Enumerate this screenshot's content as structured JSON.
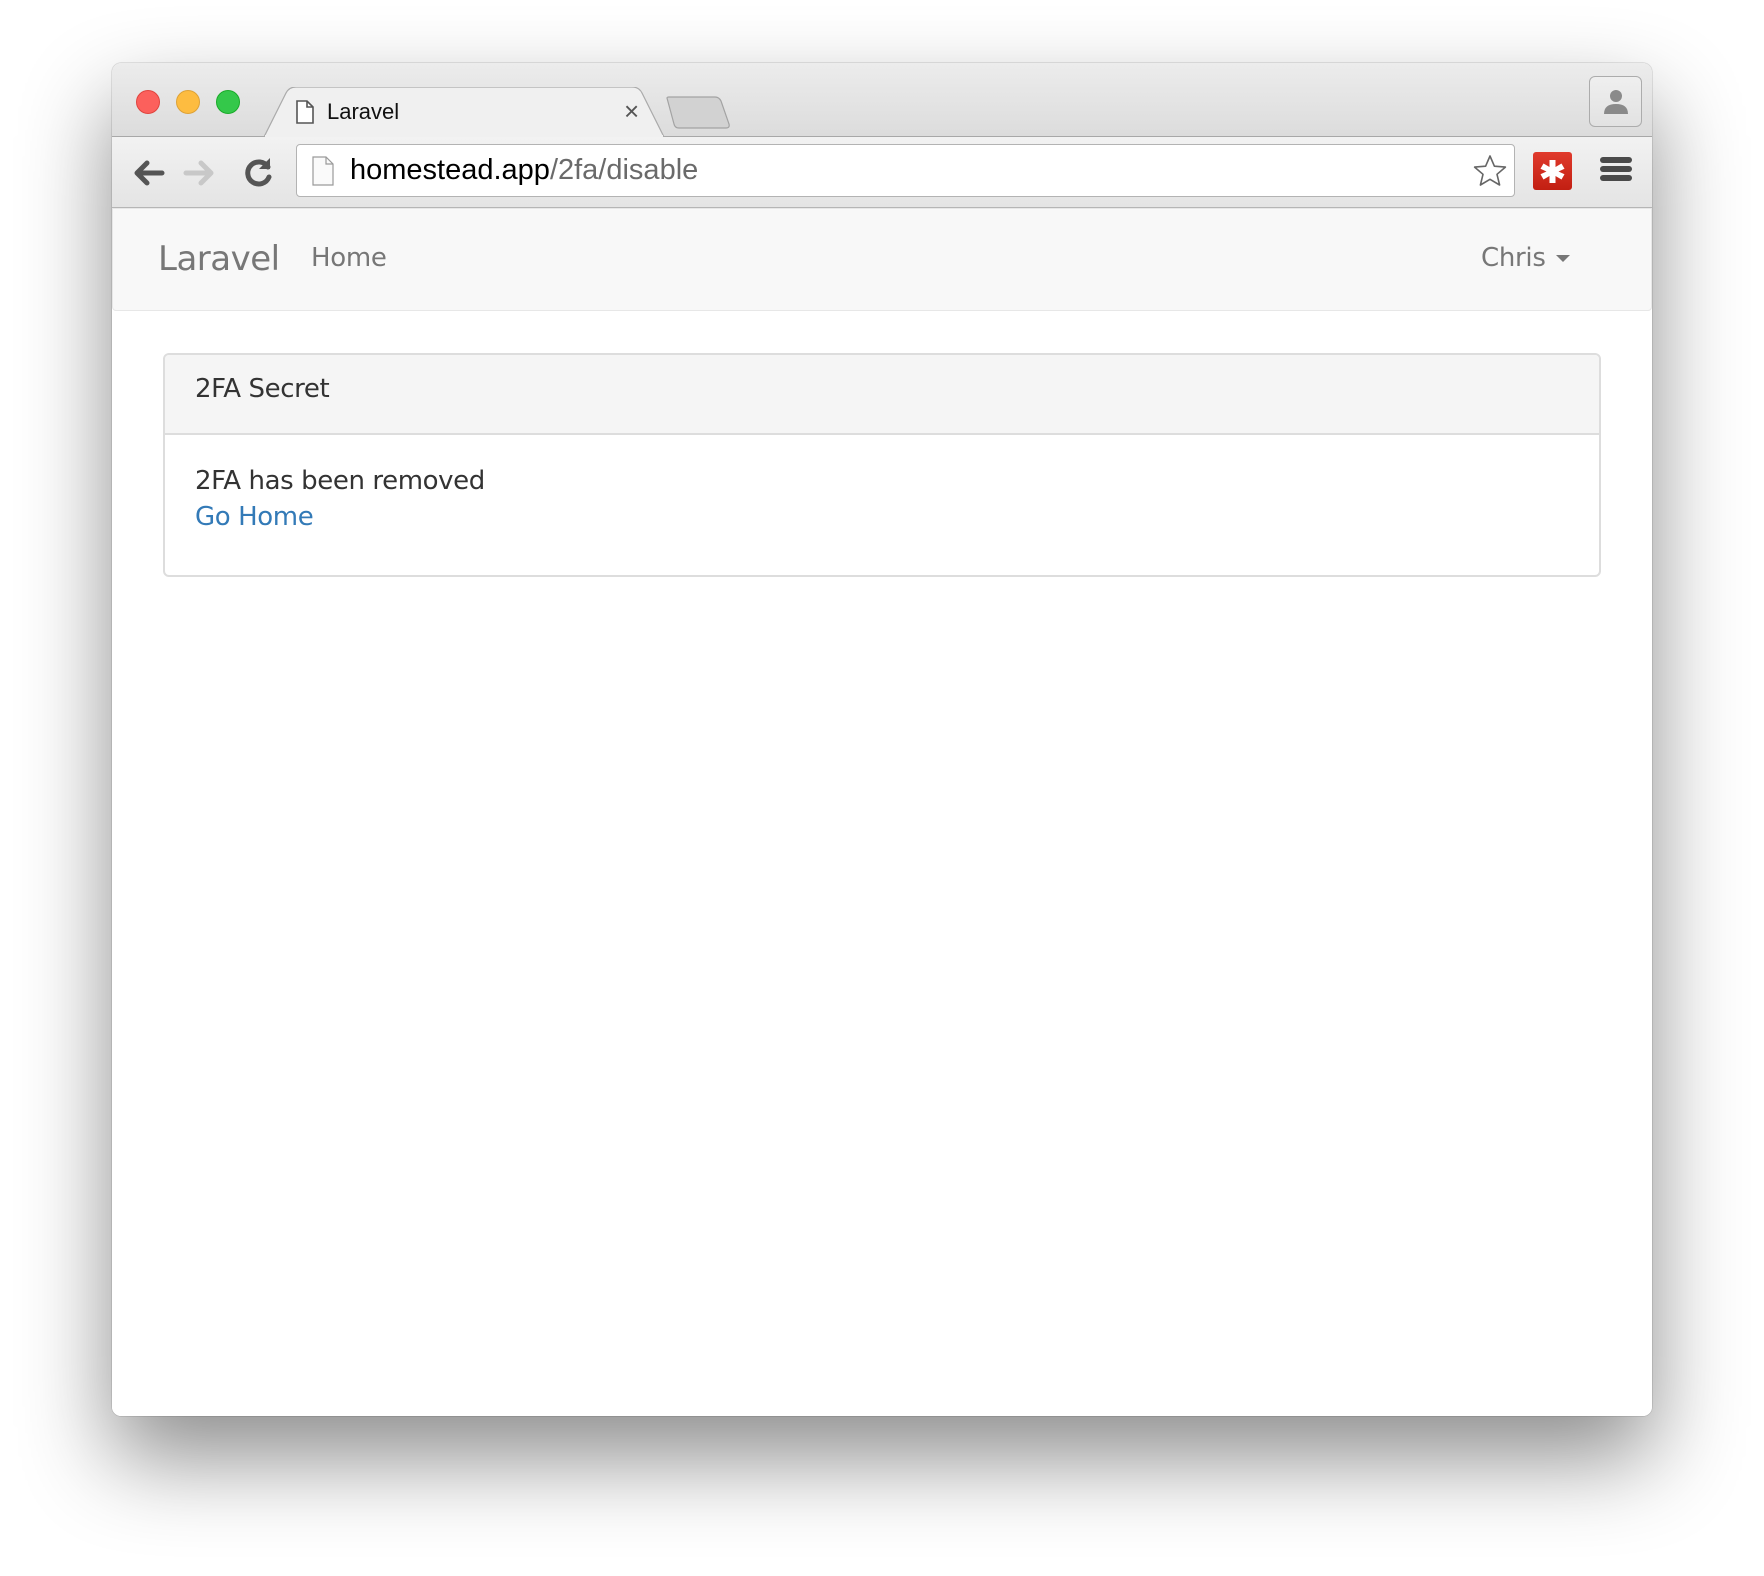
{
  "browser": {
    "tab": {
      "title": "Laravel",
      "close_label": "×"
    },
    "address_bar": {
      "host": "homestead.app",
      "path": "/2fa/disable"
    },
    "colors": {
      "extension_red": "#d32d20",
      "traffic_red": "#fc605c",
      "traffic_yellow": "#fdbc40",
      "traffic_green": "#34c84a"
    }
  },
  "navbar": {
    "brand": "Laravel",
    "links": [
      {
        "label": "Home"
      }
    ],
    "user": {
      "name": "Chris"
    }
  },
  "panel": {
    "heading": "2FA Secret",
    "message": "2FA has been removed",
    "link_label": "Go Home",
    "link_color": "#337ab7"
  }
}
